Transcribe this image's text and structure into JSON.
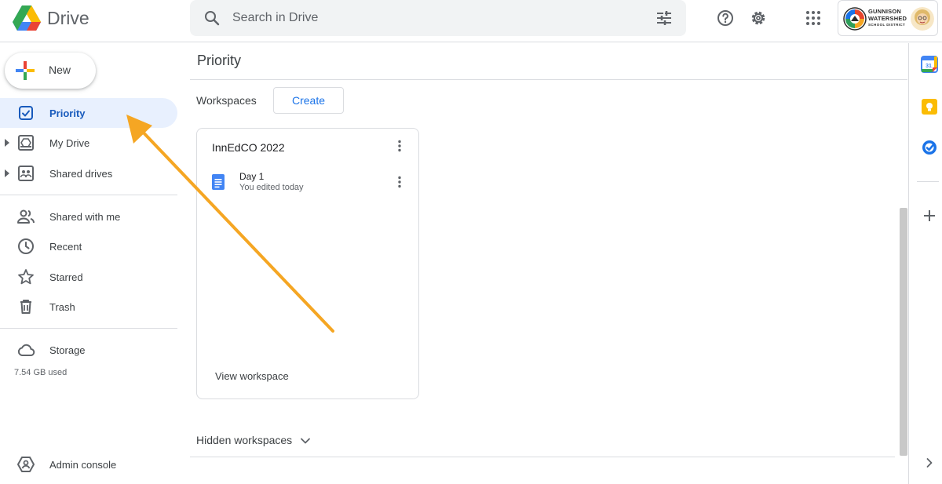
{
  "app": {
    "name": "Drive"
  },
  "search": {
    "placeholder": "Search in Drive"
  },
  "account": {
    "org_line1": "GUNNISON",
    "org_line2": "WATERSHED",
    "org_line3": "SCHOOL DISTRICT"
  },
  "sidebar": {
    "new_label": "New",
    "items": [
      {
        "label": "Priority",
        "icon": "priority-check-icon",
        "active": true
      },
      {
        "label": "My Drive",
        "icon": "my-drive-icon"
      },
      {
        "label": "Shared drives",
        "icon": "shared-drives-icon"
      },
      {
        "label": "Shared with me",
        "icon": "people-icon"
      },
      {
        "label": "Recent",
        "icon": "clock-icon"
      },
      {
        "label": "Starred",
        "icon": "star-icon"
      },
      {
        "label": "Trash",
        "icon": "trash-icon"
      },
      {
        "label": "Storage",
        "icon": "cloud-icon"
      },
      {
        "label": "Admin console",
        "icon": "admin-icon"
      }
    ],
    "storage_used": "7.54 GB used"
  },
  "main": {
    "title": "Priority",
    "workspaces_label": "Workspaces",
    "create_label": "Create",
    "card": {
      "title": "InnEdCO 2022",
      "files": [
        {
          "name": "Day 1",
          "subtitle": "You edited today"
        }
      ],
      "view_label": "View workspace"
    },
    "hidden_label": "Hidden workspaces"
  },
  "colors": {
    "accent": "#1a73e8",
    "active_bg": "#e8f0fe",
    "arrow": "#f5a623"
  }
}
